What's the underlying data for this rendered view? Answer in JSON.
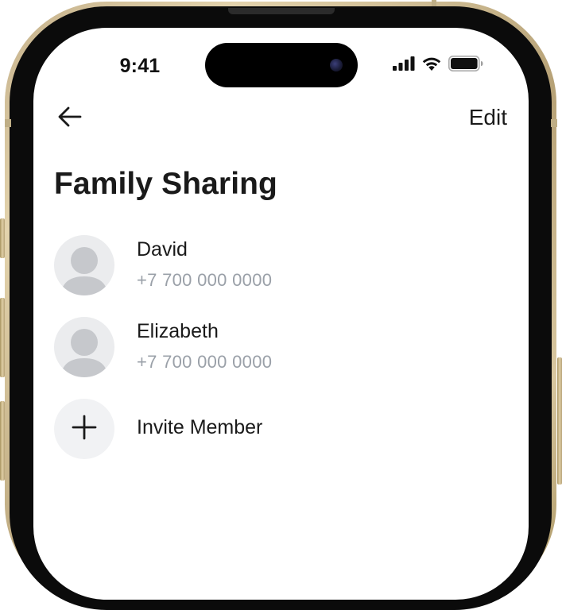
{
  "status_bar": {
    "time": "9:41"
  },
  "nav": {
    "edit_label": "Edit"
  },
  "page": {
    "title": "Family Sharing"
  },
  "members": [
    {
      "name": "David",
      "phone": "+7 700 000 0000"
    },
    {
      "name": "Elizabeth",
      "phone": "+7 700 000 0000"
    }
  ],
  "invite": {
    "label": "Invite Member"
  },
  "colors": {
    "text": "#1a1a1a",
    "secondary_text": "#9aa0a8",
    "avatar_bg": "#ebecee",
    "avatar_figure": "#c6c8cc",
    "frame_gold": "#c4b08a"
  }
}
